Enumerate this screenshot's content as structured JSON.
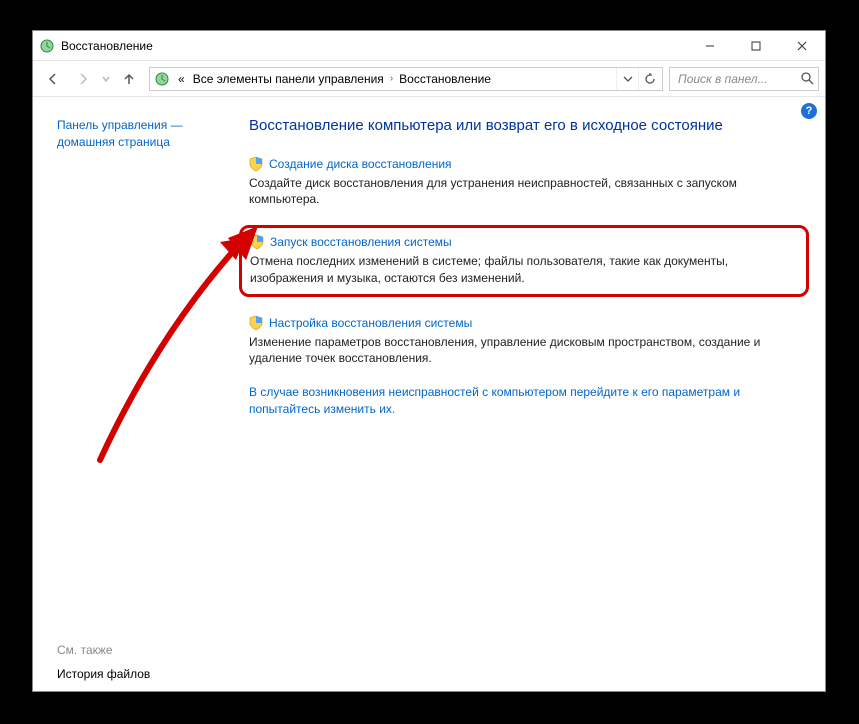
{
  "window_title": "Восстановление",
  "breadcrumbs": {
    "prefix": "«",
    "seg1": "Все элементы панели управления",
    "seg2": "Восстановление"
  },
  "search_placeholder": "Поиск в панел...",
  "sidebar": {
    "home_link": "Панель управления — домашняя страница",
    "see_also_label": "См. также",
    "see_also_link": "История файлов"
  },
  "main": {
    "title": "Восстановление компьютера или возврат его в исходное состояние",
    "items": [
      {
        "link": "Создание диска восстановления",
        "desc": "Создайте диск восстановления для устранения неисправностей, связанных с запуском компьютера."
      },
      {
        "link": "Запуск восстановления системы",
        "desc": "Отмена последних изменений в системе; файлы пользователя, такие как документы, изображения и музыка, остаются без изменений."
      },
      {
        "link": "Настройка восстановления системы",
        "desc": "Изменение параметров восстановления, управление дисковым пространством, создание и удаление точек восстановления."
      }
    ],
    "bottom_link": "В случае возникновения неисправностей с компьютером перейдите к его параметрам и попытайтесь изменить их."
  },
  "help": "?"
}
